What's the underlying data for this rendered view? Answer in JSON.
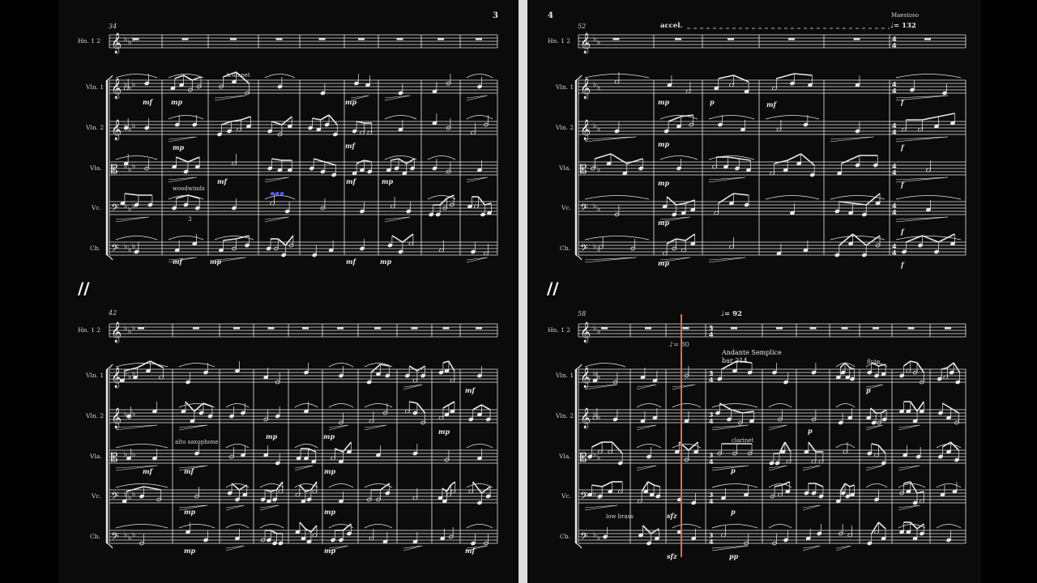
{
  "pages": {
    "left": {
      "page_number": "3"
    },
    "right": {
      "page_number": "4"
    }
  },
  "instruments": [
    "Hn. 1 2",
    "Vln. 1",
    "Vln. 2",
    "Vla.",
    "Vc.",
    "Cb."
  ],
  "systems": {
    "left_top": {
      "bar_number": "34"
    },
    "left_bottom": {
      "bar_number": "42"
    },
    "right_top": {
      "bar_number": "52"
    },
    "right_bottom": {
      "bar_number": "58"
    }
  },
  "annotations": {
    "trumpet": "trumpet",
    "woodwinds": "woodwinds",
    "alto_saxophone": "alto saxophone",
    "low_brass": "low brass",
    "clarinet": "clarinet",
    "flute": "flute",
    "accel": "accel.",
    "maestoso": "Maestoso",
    "tempo_132": "♩= 132",
    "tempo_92": "♩= 92",
    "tempo_80": "♪= 80",
    "andante": "Andante Semplice",
    "bar_ref": "bar 214",
    "tuplet_3": "3"
  },
  "dynamics": {
    "mf": "mf",
    "mp": "mp",
    "p": "p",
    "f": "f",
    "pp": "pp",
    "sfz": "sfz"
  },
  "system_break_glyph": "//",
  "colors": {
    "background": "#000000",
    "page": "#0b0b0b",
    "ink": "#e8e8e8",
    "gutter": "#dcdcdc",
    "playback_cursor": "#d9733a",
    "highlight_note": "#5a5aff"
  }
}
